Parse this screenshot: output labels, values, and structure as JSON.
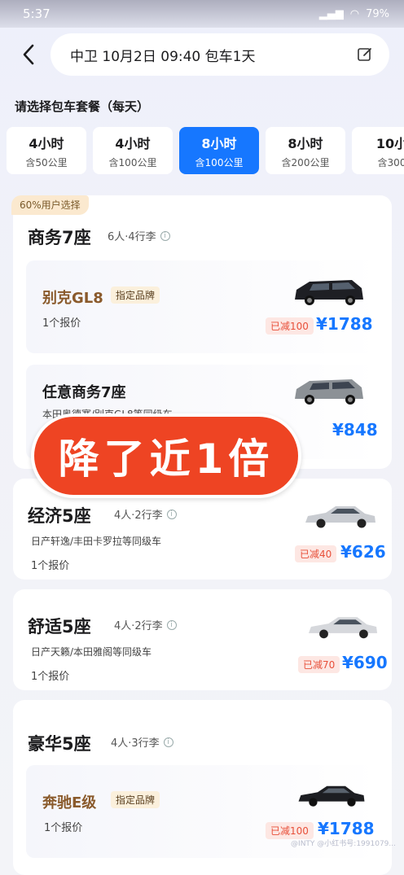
{
  "status_bar": {
    "time": "5:37",
    "battery": "79%"
  },
  "header": {
    "trip": "中卫  10月2日 09:40 包车1天"
  },
  "section_title": "请选择包车套餐（每天）",
  "packages": [
    {
      "title": "4小时",
      "sub": "含50公里"
    },
    {
      "title": "4小时",
      "sub": "含100公里"
    },
    {
      "title": "8小时",
      "sub": "含100公里",
      "selected": true
    },
    {
      "title": "8小时",
      "sub": "含200公里"
    },
    {
      "title": "10小",
      "sub": "含300"
    }
  ],
  "hot_badge": "60%用户选择",
  "groups": {
    "business7": {
      "title": "商务7座",
      "meta": "6人·4行李",
      "options": [
        {
          "title": "别克GL8",
          "tag": "指定品牌",
          "quote": "1个报价",
          "discount": "已减100",
          "price": "¥1788"
        },
        {
          "title": "任意商务7座",
          "desc": "本田奥德赛/别克GL8等同级车",
          "price": "¥848"
        }
      ]
    },
    "economy5": {
      "title": "经济5座",
      "meta": "4人·2行李",
      "desc": "日产轩逸/丰田卡罗拉等同级车",
      "quote": "1个报价",
      "discount": "已减40",
      "price": "¥626"
    },
    "comfort5": {
      "title": "舒适5座",
      "meta": "4人·2行李",
      "desc": "日产天籁/本田雅阁等同级车",
      "quote": "1个报价",
      "discount": "已减70",
      "price": "¥690"
    },
    "luxury5": {
      "title": "豪华5座",
      "meta": "4人·3行李",
      "options": [
        {
          "title": "奔驰E级",
          "tag": "指定品牌",
          "quote": "1个报价",
          "discount": "已减100",
          "price": "¥1788"
        }
      ]
    }
  },
  "sticker": "降了近1倍",
  "watermark": "@INTY  @小红书号:1991079..."
}
